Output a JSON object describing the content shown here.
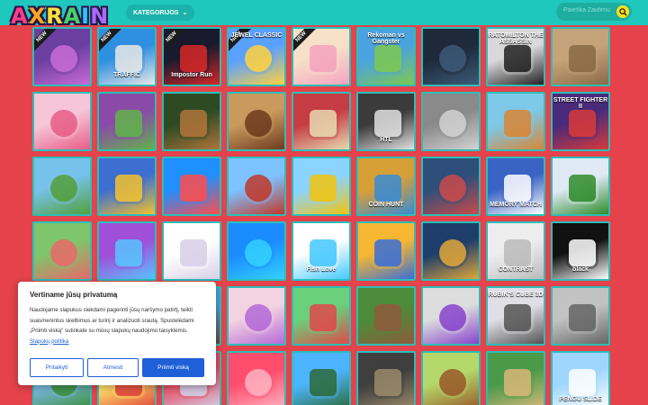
{
  "header": {
    "logo": "AXRAIN",
    "menu_label": "KATEGORIJOS",
    "search_placeholder": "Paieška Žaidimu"
  },
  "colors": {
    "background": "#e5424b",
    "topbar": "#1fc8bd",
    "tile_border": "#2bbfb8",
    "accent": "#ffe11a"
  },
  "games": [
    {
      "label": "",
      "new": true
    },
    {
      "label": "TRAFFIC",
      "new": true
    },
    {
      "label": "Impostor Run",
      "new": true
    },
    {
      "label": "JEWEL CLASSIC",
      "new": true
    },
    {
      "label": "",
      "new": true
    },
    {
      "label": "Rekoman vs Gangster"
    },
    {
      "label": ""
    },
    {
      "label": "RATOMILTON THE ASSASSIN"
    },
    {
      "label": ""
    },
    {
      "label": ""
    },
    {
      "label": ""
    },
    {
      "label": ""
    },
    {
      "label": ""
    },
    {
      "label": ""
    },
    {
      "label": "HTL"
    },
    {
      "label": ""
    },
    {
      "label": ""
    },
    {
      "label": "STREET FIGHTER II"
    },
    {
      "label": ""
    },
    {
      "label": ""
    },
    {
      "label": ""
    },
    {
      "label": ""
    },
    {
      "label": ""
    },
    {
      "label": "COIN HUNT"
    },
    {
      "label": ""
    },
    {
      "label": "MEMORY MATCH"
    },
    {
      "label": ""
    },
    {
      "label": ""
    },
    {
      "label": ""
    },
    {
      "label": ""
    },
    {
      "label": ""
    },
    {
      "label": "Fish Love"
    },
    {
      "label": ""
    },
    {
      "label": ""
    },
    {
      "label": "CONTRAST"
    },
    {
      "label": "black"
    },
    {
      "label": ""
    },
    {
      "label": ""
    },
    {
      "label": ""
    },
    {
      "label": ""
    },
    {
      "label": ""
    },
    {
      "label": ""
    },
    {
      "label": ""
    },
    {
      "label": "RUBIK'S CUBE 3D"
    },
    {
      "label": ""
    },
    {
      "label": ""
    },
    {
      "label": ""
    },
    {
      "label": ""
    },
    {
      "label": ""
    },
    {
      "label": ""
    },
    {
      "label": ""
    },
    {
      "label": ""
    },
    {
      "label": ""
    },
    {
      "label": "PENGU SLIDE"
    }
  ],
  "new_badge": "NEW",
  "cookie": {
    "title": "Vertiname jūsų privatumą",
    "body": "Naudojame slapukus siekdami pagerinti jūsų naršymo patirtį, teikti suasmenintus skelbimus ar turinį ir analizuoti srautą. Spustelėdami „Priimti viską\" sutinkate su mūsų slapukų naudojimo taisyklėmis.",
    "link": "Slapukų politika",
    "customize": "Pritaikyti",
    "reject": "Atmesti",
    "accept": "Priimti viską"
  }
}
